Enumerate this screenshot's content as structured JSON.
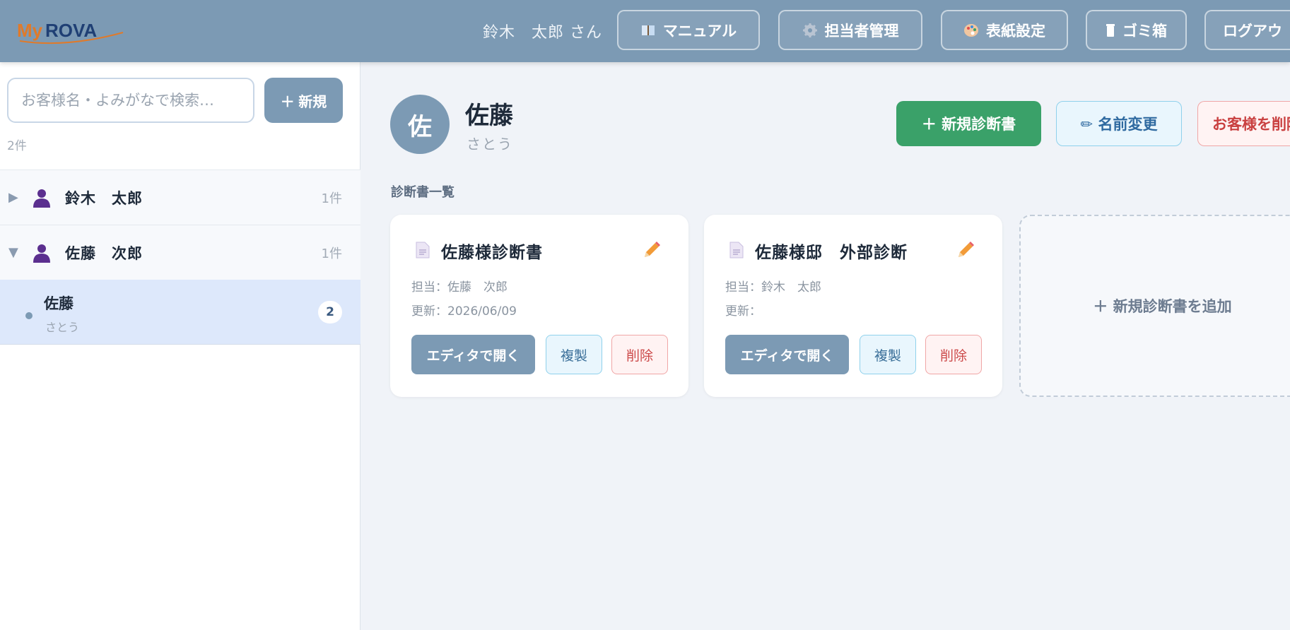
{
  "header": {
    "logo_text": "MyROVA",
    "user_greeting": "鈴木　太郎 さん",
    "buttons": [
      {
        "label": "マニュアル",
        "icon": "book-icon"
      },
      {
        "label": "担当者管理",
        "icon": "gear-icon"
      },
      {
        "label": "表紙設定",
        "icon": "palette-icon"
      },
      {
        "label": "ゴミ箱",
        "icon": "trash-icon"
      },
      {
        "label": "ログアウ",
        "icon": ""
      }
    ]
  },
  "sidebar": {
    "search_placeholder": "お客様名・よみがなで検索…",
    "new_button": "＋ 新規",
    "count": "2件",
    "groups": [
      {
        "name": "鈴木　太郎",
        "count": "1件",
        "expanded": false
      },
      {
        "name": "佐藤　次郎",
        "count": "1件",
        "expanded": true
      }
    ],
    "selected_customer": {
      "name": "佐藤",
      "kana": "さとう",
      "badge": "2"
    }
  },
  "main": {
    "avatar_char": "佐",
    "customer_name": "佐藤",
    "customer_kana": "さとう",
    "actions": {
      "new_report": "＋ 新規診断書",
      "rename": "✏ 名前変更",
      "delete_customer": "お客様を削除"
    },
    "section_label": "診断書一覧",
    "reports": [
      {
        "title": "佐藤様診断書",
        "assignee": "担当：佐藤　次郎",
        "updated": "更新：2026/06/09"
      },
      {
        "title": "佐藤様邸　外部診断",
        "assignee": "担当：鈴木　太郎",
        "updated": "更新："
      }
    ],
    "card_buttons": {
      "open": "エディタで開く",
      "duplicate": "複製",
      "delete": "削除"
    },
    "add_report": "＋ 新規診断書を追加"
  },
  "colors": {
    "header_bg": "#7c9ab4",
    "primary": "#7c9ab4",
    "success": "#3aa169",
    "danger": "#c94040",
    "selected_row": "#dde8fb"
  }
}
